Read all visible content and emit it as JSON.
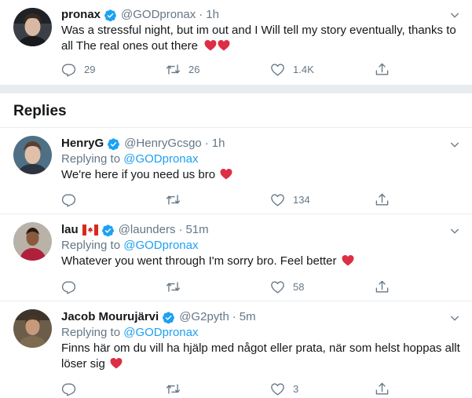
{
  "main_tweet": {
    "name": "pronax",
    "handle": "@GODpronax",
    "separator": "·",
    "time": "1h",
    "text": "Was a stressful night, but im out and I Will tell my story eventually, thanks to all The real ones out there",
    "heart_emojis": 2,
    "reply_count": "29",
    "retweet_count": "26",
    "like_count": "1.4K",
    "verified": true
  },
  "replies_section": {
    "title": "Replies"
  },
  "replies": [
    {
      "name": "HenryG",
      "handle": "@HenryGcsgo",
      "separator": "·",
      "time": "1h",
      "replying_prefix": "Replying to",
      "replying_mention": "@GODpronax",
      "text": "We're here if you need us bro",
      "reply_count": "",
      "retweet_count": "",
      "like_count": "134"
    },
    {
      "name": "lau",
      "handle": "@launders",
      "separator": "·",
      "time": "51m",
      "replying_prefix": "Replying to",
      "replying_mention": "@GODpronax",
      "text": "Whatever you went through I'm sorry bro. Feel better",
      "reply_count": "",
      "retweet_count": "",
      "like_count": "58"
    },
    {
      "name": "Jacob Mourujärvi",
      "handle": "@G2pyth",
      "separator": "·",
      "time": "5m",
      "replying_prefix": "Replying to",
      "replying_mention": "@GODpronax",
      "text": "Finns här om du vill ha hjälp med något eller prata, när som helst hoppas allt löser sig",
      "reply_count": "",
      "retweet_count": "",
      "like_count": "3"
    }
  ],
  "colors": {
    "accent": "#1da1f2",
    "secondary_text": "#657786",
    "primary_text": "#14171a",
    "heart": "#e0245e",
    "divider": "#e6ecf0"
  },
  "icons": {
    "verified": "verified-badge-icon",
    "menu": "chevron-down-icon",
    "reply": "reply-icon",
    "retweet": "retweet-icon",
    "like": "heart-icon",
    "share": "share-icon"
  }
}
